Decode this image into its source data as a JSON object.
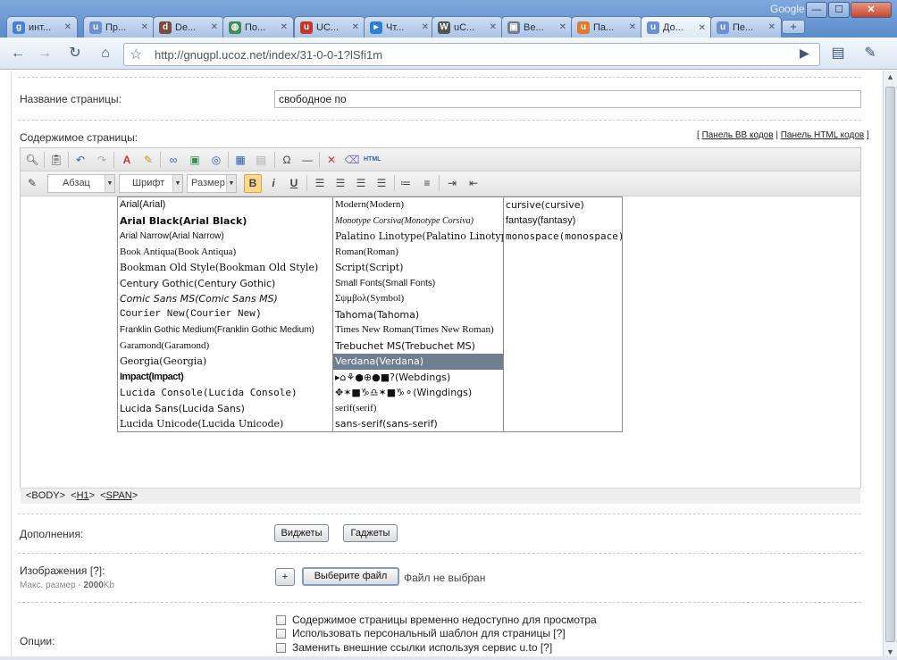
{
  "window": {
    "brand": "Google",
    "min_label": "—",
    "max_label": "☐",
    "close_label": "✕"
  },
  "tabs": [
    {
      "title": "инт...",
      "icon": "google-icon",
      "color": "#4a7fd4",
      "glyph": "g"
    },
    {
      "title": "Пр...",
      "icon": "ucoz-icon",
      "color": "#6b8fd1",
      "glyph": "u"
    },
    {
      "title": "De...",
      "icon": "deviantart-icon",
      "color": "#7a4a3a",
      "glyph": "d"
    },
    {
      "title": "По...",
      "icon": "globe-icon",
      "color": "#3b8f4f",
      "glyph": "◍"
    },
    {
      "title": "UC...",
      "icon": "ucoz-red-icon",
      "color": "#c0392b",
      "glyph": "u"
    },
    {
      "title": "Чт...",
      "icon": "play-icon",
      "color": "#2f7fd1",
      "glyph": "▸"
    },
    {
      "title": "uC...",
      "icon": "wikipedia-icon",
      "color": "#555555",
      "glyph": "W"
    },
    {
      "title": "Ве...",
      "icon": "image-icon",
      "color": "#6e7c8c",
      "glyph": "▣"
    },
    {
      "title": "Па...",
      "icon": "ucoz-orange-icon",
      "color": "#e07a2e",
      "glyph": "u"
    },
    {
      "title": "До...",
      "icon": "ucoz-icon",
      "color": "#6b8fd1",
      "glyph": "u",
      "active": true
    },
    {
      "title": "Пе...",
      "icon": "ucoz-icon",
      "color": "#6b8fd1",
      "glyph": "u"
    }
  ],
  "toolbar": {
    "url": "http://gnugpl.ucoz.net/index/31-0-0-1?lSfi1m"
  },
  "form": {
    "title_label": "Название страницы:",
    "title_value": "свободное по",
    "content_label": "Содержимое страницы:",
    "panel_bb": "Панель BB кодов",
    "panel_html": "Панель HTML кодов",
    "addons_label": "Дополнения:",
    "widgets_btn": "Виджеты",
    "gadgets_btn": "Гаджеты",
    "images_label": "Изображения [?]:",
    "images_hint_prefix": "Макс. размер - ",
    "images_hint_size": "2000",
    "images_hint_unit": "Kb",
    "add_btn": "+",
    "choose_file_btn": "Выберите файл",
    "no_file_text": "Файл не выбран",
    "options_label": "Опции:",
    "options": [
      "Содержимое страницы временно недоступно для просмотра",
      "Использовать персональный шаблон для страницы [?]",
      "Заменить внешние ссылки используя сервис u.to [?]"
    ]
  },
  "editor": {
    "paragraph_combo": "Абзац",
    "font_combo": "Шрифт",
    "size_combo": "Размер",
    "bold": "B",
    "italic": "i",
    "underline": "U",
    "status_body": "<BODY>",
    "status_h1": "H1",
    "status_span": "SPAN",
    "fonts_col1": [
      "Arial(Arial)",
      "Arial Black(Arial Black)",
      "Arial Narrow(Arial Narrow)",
      "Book Antiqua(Book Antiqua)",
      "Bookman Old Style(Bookman Old Style)",
      "Century Gothic(Century Gothic)",
      "Comic Sans MS(Comic Sans MS)",
      "Courier New(Courier New)",
      "Franklin Gothic Medium(Franklin Gothic Medium)",
      "Garamond(Garamond)",
      "Georgia(Georgia)",
      "Impact(Impact)",
      "Lucida Console(Lucida Console)",
      "Lucida Sans(Lucida Sans)",
      "Lucida Unicode(Lucida Unicode)"
    ],
    "fonts_col2": [
      "Modern(Modern)",
      "Monotype Corsiva(Monotype Corsiva)",
      "Palatino Linotype(Palatino Linotype)",
      "Roman(Roman)",
      "Script(Script)",
      "Small Fonts(Small Fonts)",
      "Σψμβολ(Symbol)",
      "Tahoma(Tahoma)",
      "Times New Roman(Times New Roman)",
      "Trebuchet MS(Trebuchet MS)",
      "Verdana(Verdana)",
      "▸⌂⚘●⊕●■?(Webdings)",
      "✥✶■♑♎✶■♑⚬(Wingdings)",
      "serif(serif)",
      "sans-serif(sans-serif)"
    ],
    "fonts_col3": [
      "cursive(cursive)",
      "fantasy(fantasy)",
      "monospace(monospace)"
    ],
    "selected_font": "Verdana(Verdana)",
    "selection_color": "#6f7f91"
  }
}
